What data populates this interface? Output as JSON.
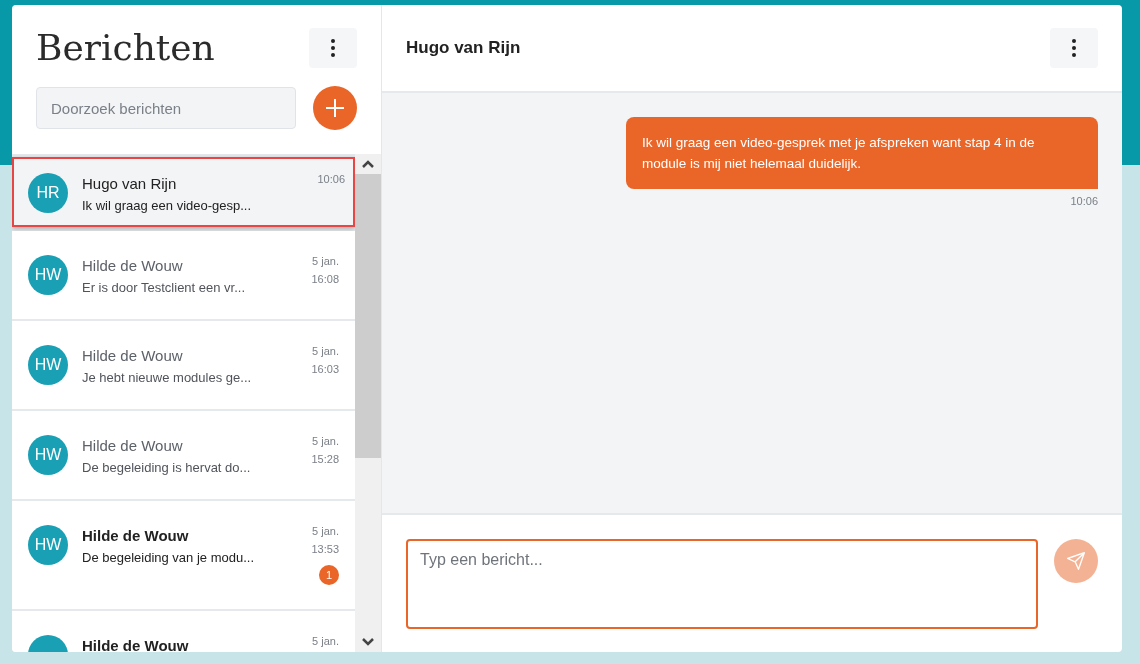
{
  "sidebar": {
    "title": "Berichten",
    "search": {
      "placeholder": "Doorzoek berichten"
    },
    "conversations": [
      {
        "initials": "HR",
        "name": "Hugo van Rijn",
        "preview": "Ik wil graag een video-gesp...",
        "time": "10:06",
        "selected": true,
        "unread": false
      },
      {
        "initials": "HW",
        "name": "Hilde de Wouw",
        "preview": "Er is door Testclient een vr...",
        "date": "5 jan.",
        "time": "16:08",
        "selected": false,
        "unread": false
      },
      {
        "initials": "HW",
        "name": "Hilde de Wouw",
        "preview": "Je hebt nieuwe modules ge...",
        "date": "5 jan.",
        "time": "16:03",
        "selected": false,
        "unread": false
      },
      {
        "initials": "HW",
        "name": "Hilde de Wouw",
        "preview": "De begeleiding is hervat do...",
        "date": "5 jan.",
        "time": "15:28",
        "selected": false,
        "unread": false
      },
      {
        "initials": "HW",
        "name": "Hilde de Wouw",
        "preview": "De begeleiding van je modu...",
        "date": "5 jan.",
        "time": "13:53",
        "selected": false,
        "unread": true,
        "badge": "1"
      },
      {
        "name": "Hilde de Wouw",
        "date": "5 jan.",
        "selected": false,
        "unread": true
      }
    ]
  },
  "chat": {
    "title": "Hugo van Rijn",
    "messages": [
      {
        "text": "Ik wil graag een video-gesprek met je afspreken want stap 4 in de module is mij niet helemaal duidelijk.",
        "time": "10:06"
      }
    ],
    "composer": {
      "placeholder": "Typ een bericht..."
    }
  }
}
